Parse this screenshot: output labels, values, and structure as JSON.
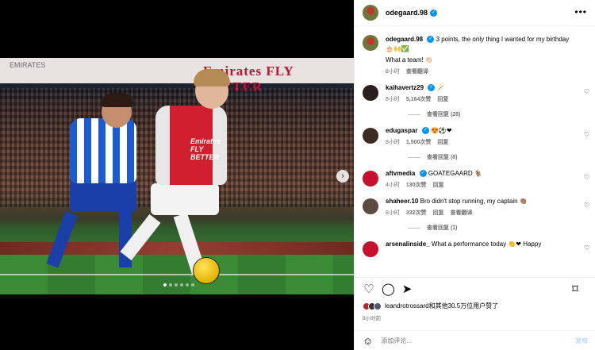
{
  "media": {
    "banner_left": "EMIRATES",
    "banner_text": "Emirates FLY BETTER",
    "sponsor": "Emirates FLY BETTER",
    "dots": 6,
    "active_dot": 0
  },
  "header": {
    "username": "odegaard.98",
    "more": "•••"
  },
  "caption": {
    "username": "odegaard.98",
    "text": "3 points, the only thing I wanted for my birthday 🎂🙌✅",
    "text2": "What a team! 👏🏻",
    "time": "8小时",
    "translate": "查看翻译"
  },
  "comments": [
    {
      "username": "kaihavertz29",
      "text": "🪄",
      "time": "8小时",
      "likes": "5,164次赞",
      "reply": "回复",
      "view_replies": "查看回复 (28)",
      "avatar_color": "#2b1e1e"
    },
    {
      "username": "edugaspar",
      "text": "😍⚽❤",
      "time": "8小时",
      "likes": "1,500次赞",
      "reply": "回复",
      "view_replies": "查看回复 (8)",
      "avatar_color": "#3b2b22"
    },
    {
      "username": "aftvmedia",
      "text": "GOATEGAARD 🐐",
      "time": "4小时",
      "likes": "130次赞",
      "reply": "回复",
      "view_replies": "",
      "avatar_color": "#c8102e"
    },
    {
      "username": "shaheer.10",
      "text": "Bro didn't stop running, my captain 👏🏽",
      "time": "8小时",
      "likes": "332次赞",
      "reply": "回复",
      "translate": "查看翻译",
      "view_replies": "查看回复 (1)",
      "avatar_color": "#5a4a40"
    },
    {
      "username": "arsenalinside_",
      "text": "What a performance today 👏❤ Happy",
      "time": "",
      "likes": "",
      "reply": "",
      "view_replies": "",
      "avatar_color": "#c8102e"
    }
  ],
  "likes": {
    "text": "leandrotrossard和其他30.5万位用户赞了"
  },
  "posted": "8小时前",
  "add_comment": {
    "placeholder": "添加评论...",
    "post_label": "发布"
  },
  "icons": {
    "heart": "heart-icon",
    "comment": "comment-icon",
    "share": "share-icon",
    "bookmark": "bookmark-icon",
    "emoji": "emoji-icon",
    "more": "more-icon",
    "next": "chevron-right-icon"
  }
}
